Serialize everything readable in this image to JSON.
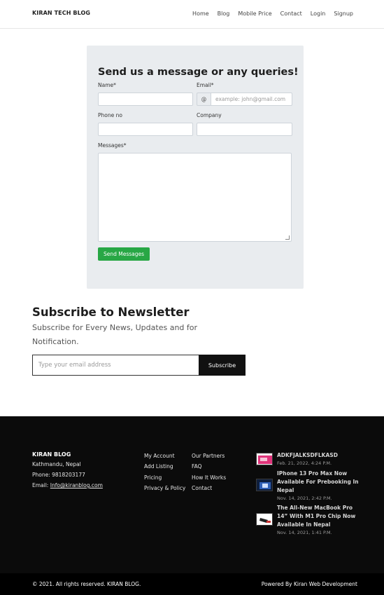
{
  "header": {
    "brand": "KIRAN TECH BLOG",
    "nav": [
      "Home",
      "Blog",
      "Mobile Price",
      "Contact",
      "Login",
      "Signup"
    ]
  },
  "contact": {
    "title": "Send us a message or any queries!",
    "name_label": "Name*",
    "email_label": "Email*",
    "email_prefix": "@",
    "email_placeholder": "example: john@gmail.com",
    "phone_label": "Phone no",
    "company_label": "Company",
    "messages_label": "Messages*",
    "send_label": "Send Messages"
  },
  "newsletter": {
    "title": "Subscribe to Newsletter",
    "subtitle": "Subscribe for Every News, Updates and for Notification.",
    "email_placeholder": "Type your email address",
    "subscribe_label": "Subscribe"
  },
  "footer": {
    "brand": "KIRAN BLOG",
    "address": "Kathmandu, Nepal",
    "phone": "Phone: 9818203177",
    "email_prefix": "Email: ",
    "email": "Info@kiranblog.com",
    "links_col1": [
      "My Account",
      "Add Listing",
      "Pricing",
      "Privacy & Policy"
    ],
    "links_col2": [
      "Our Partners",
      "FAQ",
      "How It Works",
      "Contact"
    ],
    "posts": [
      {
        "title": "ADKFJALKSDFLKASD",
        "date": "Feb. 21, 2022, 4:24 P.M."
      },
      {
        "title": "IPhone 13 Pro Max Now Available For Prebooking In Nepal",
        "date": "Nov. 14, 2021, 2:42 P.M."
      },
      {
        "title": "The All-New MacBook Pro 14” With M1 Pro Chip Now Available In Nepal",
        "date": "Nov. 14, 2021, 1:41 P.M."
      }
    ],
    "copyright": "© 2021. All rights reserved. KIRAN BLOG.",
    "powered": "Powered By Kiran Web Development"
  },
  "colors": {
    "accent_green": "#28a745",
    "footer_bg": "#0b0b0b",
    "card_bg": "#e9ecef"
  }
}
